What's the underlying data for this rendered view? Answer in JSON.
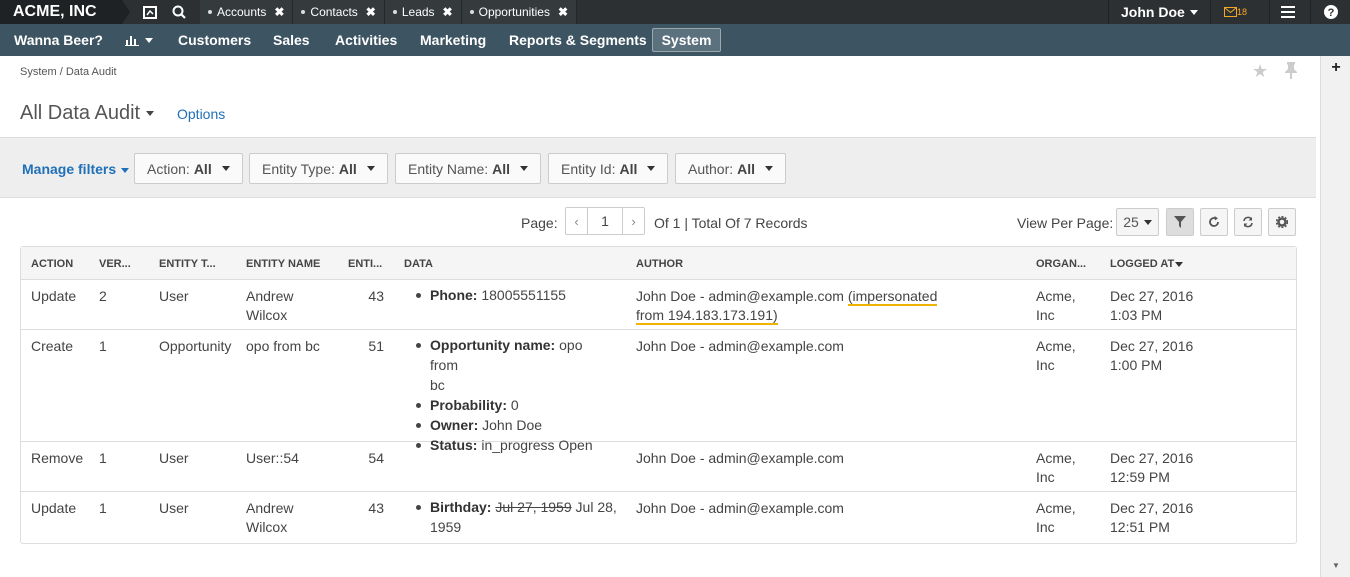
{
  "topbar": {
    "brand": "ACME, INC",
    "tabs": [
      {
        "label": "Accounts"
      },
      {
        "label": "Contacts"
      },
      {
        "label": "Leads"
      },
      {
        "label": "Opportunities"
      }
    ],
    "user_name": "John Doe",
    "mail_count": "18",
    "colors": {
      "bar": "#2c3033",
      "nav": "#3d5463",
      "accent": "#2070b8",
      "highlight": "#f0b400"
    }
  },
  "nav": {
    "items": [
      "Wanna Beer?",
      "Customers",
      "Sales",
      "Activities",
      "Marketing",
      "Reports & Segments",
      "System"
    ],
    "active": "System"
  },
  "breadcrumb": "System / Data Audit",
  "page": {
    "title": "All Data Audit",
    "options": "Options"
  },
  "filters": {
    "manage": "Manage filters",
    "items": [
      {
        "label": "Action:",
        "value": "All"
      },
      {
        "label": "Entity Type:",
        "value": "All"
      },
      {
        "label": "Entity Name:",
        "value": "All"
      },
      {
        "label": "Entity Id:",
        "value": "All"
      },
      {
        "label": "Author:",
        "value": "All"
      }
    ]
  },
  "pager": {
    "page_label": "Page:",
    "page": "1",
    "total": "Of 1 | Total Of 7 Records",
    "view_label": "View Per Page:",
    "per_page": "25"
  },
  "grid": {
    "columns": [
      "ACTION",
      "VER...",
      "ENTITY T...",
      "ENTITY NAME",
      "ENTI...",
      "DATA",
      "AUTHOR",
      "ORGAN...",
      "LOGGED AT"
    ],
    "rows": [
      {
        "action": "Update",
        "version": "2",
        "entity_type": "User",
        "entity_name_1": "Andrew",
        "entity_name_2": "Wilcox",
        "entity_id": "43",
        "author": "John Doe - admin@example.com",
        "impersonation_1": "(impersonated",
        "impersonation_2": "from 194.183.173.191)",
        "org_1": "Acme,",
        "org_2": "Inc",
        "logged_1": "Dec 27, 2016",
        "logged_2": "1:03 PM",
        "data": [
          {
            "key": "Phone:",
            "value": "18005551155"
          }
        ]
      },
      {
        "action": "Create",
        "version": "1",
        "entity_type": "Opportunity",
        "entity_name_1": "opo from bc",
        "entity_id": "51",
        "author": "John Doe - admin@example.com",
        "org_1": "Acme,",
        "org_2": "Inc",
        "logged_1": "Dec 27, 2016",
        "logged_2": "1:00 PM",
        "data": [
          {
            "key": "Opportunity name:",
            "value": "opo from",
            "value2": "bc"
          },
          {
            "key": "Probability:",
            "value": "0"
          },
          {
            "key": "Owner:",
            "value": "John Doe"
          },
          {
            "key": "Status:",
            "value": "in_progress Open"
          }
        ]
      },
      {
        "action": "Remove",
        "version": "1",
        "entity_type": "User",
        "entity_name_1": "User::54",
        "entity_id": "54",
        "author": "John Doe - admin@example.com",
        "org_1": "Acme,",
        "org_2": "Inc",
        "logged_1": "Dec 27, 2016",
        "logged_2": "12:59 PM"
      },
      {
        "action": "Update",
        "version": "1",
        "entity_type": "User",
        "entity_name_1": "Andrew",
        "entity_name_2": "Wilcox",
        "entity_id": "43",
        "author": "John Doe - admin@example.com",
        "org_1": "Acme,",
        "org_2": "Inc",
        "logged_1": "Dec 27, 2016",
        "logged_2": "12:51 PM",
        "data": [
          {
            "key": "Birthday:",
            "old": "Jul 27, 1959",
            "value": "Jul 28,",
            "value2": "1959"
          }
        ]
      }
    ]
  }
}
